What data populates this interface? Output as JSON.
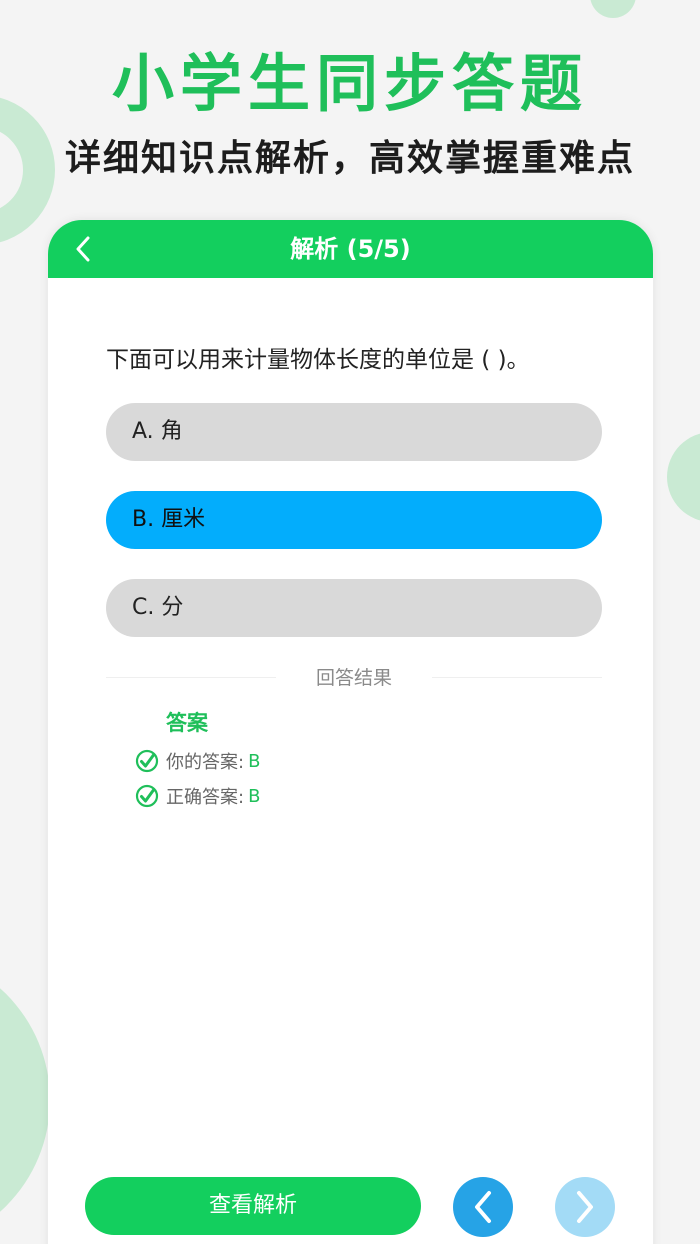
{
  "headline": "小学生同步答题",
  "subline": "详细知识点解析，高效掌握重难点",
  "navbar": {
    "back_icon": "chevron-left-icon",
    "title": "解析 (5/5)"
  },
  "question": "下面可以用来计量物体长度的单位是 ( )。",
  "options": [
    {
      "label": "A. 角",
      "selected": false
    },
    {
      "label": "B. 厘米",
      "selected": true
    },
    {
      "label": "C. 分",
      "selected": false
    }
  ],
  "result_label": "回答结果",
  "answer": {
    "heading": "答案",
    "rows": [
      {
        "label": "你的答案:",
        "value": "B",
        "icon": "check-circle-icon"
      },
      {
        "label": "正确答案:",
        "value": "B",
        "icon": "check-circle-icon"
      }
    ]
  },
  "footer": {
    "analysis_button": "查看解析",
    "prev_icon": "chevron-left-icon",
    "next_icon": "chevron-right-icon"
  },
  "colors": {
    "brand_green": "#13cf5e",
    "text_green": "#1fbf5a",
    "selected_blue": "#03adfc",
    "option_gray": "#d9d9d9",
    "prev_blue": "#26a3e6",
    "next_blue_light": "#a3dbf6",
    "decor_green": "#c9ead3"
  }
}
